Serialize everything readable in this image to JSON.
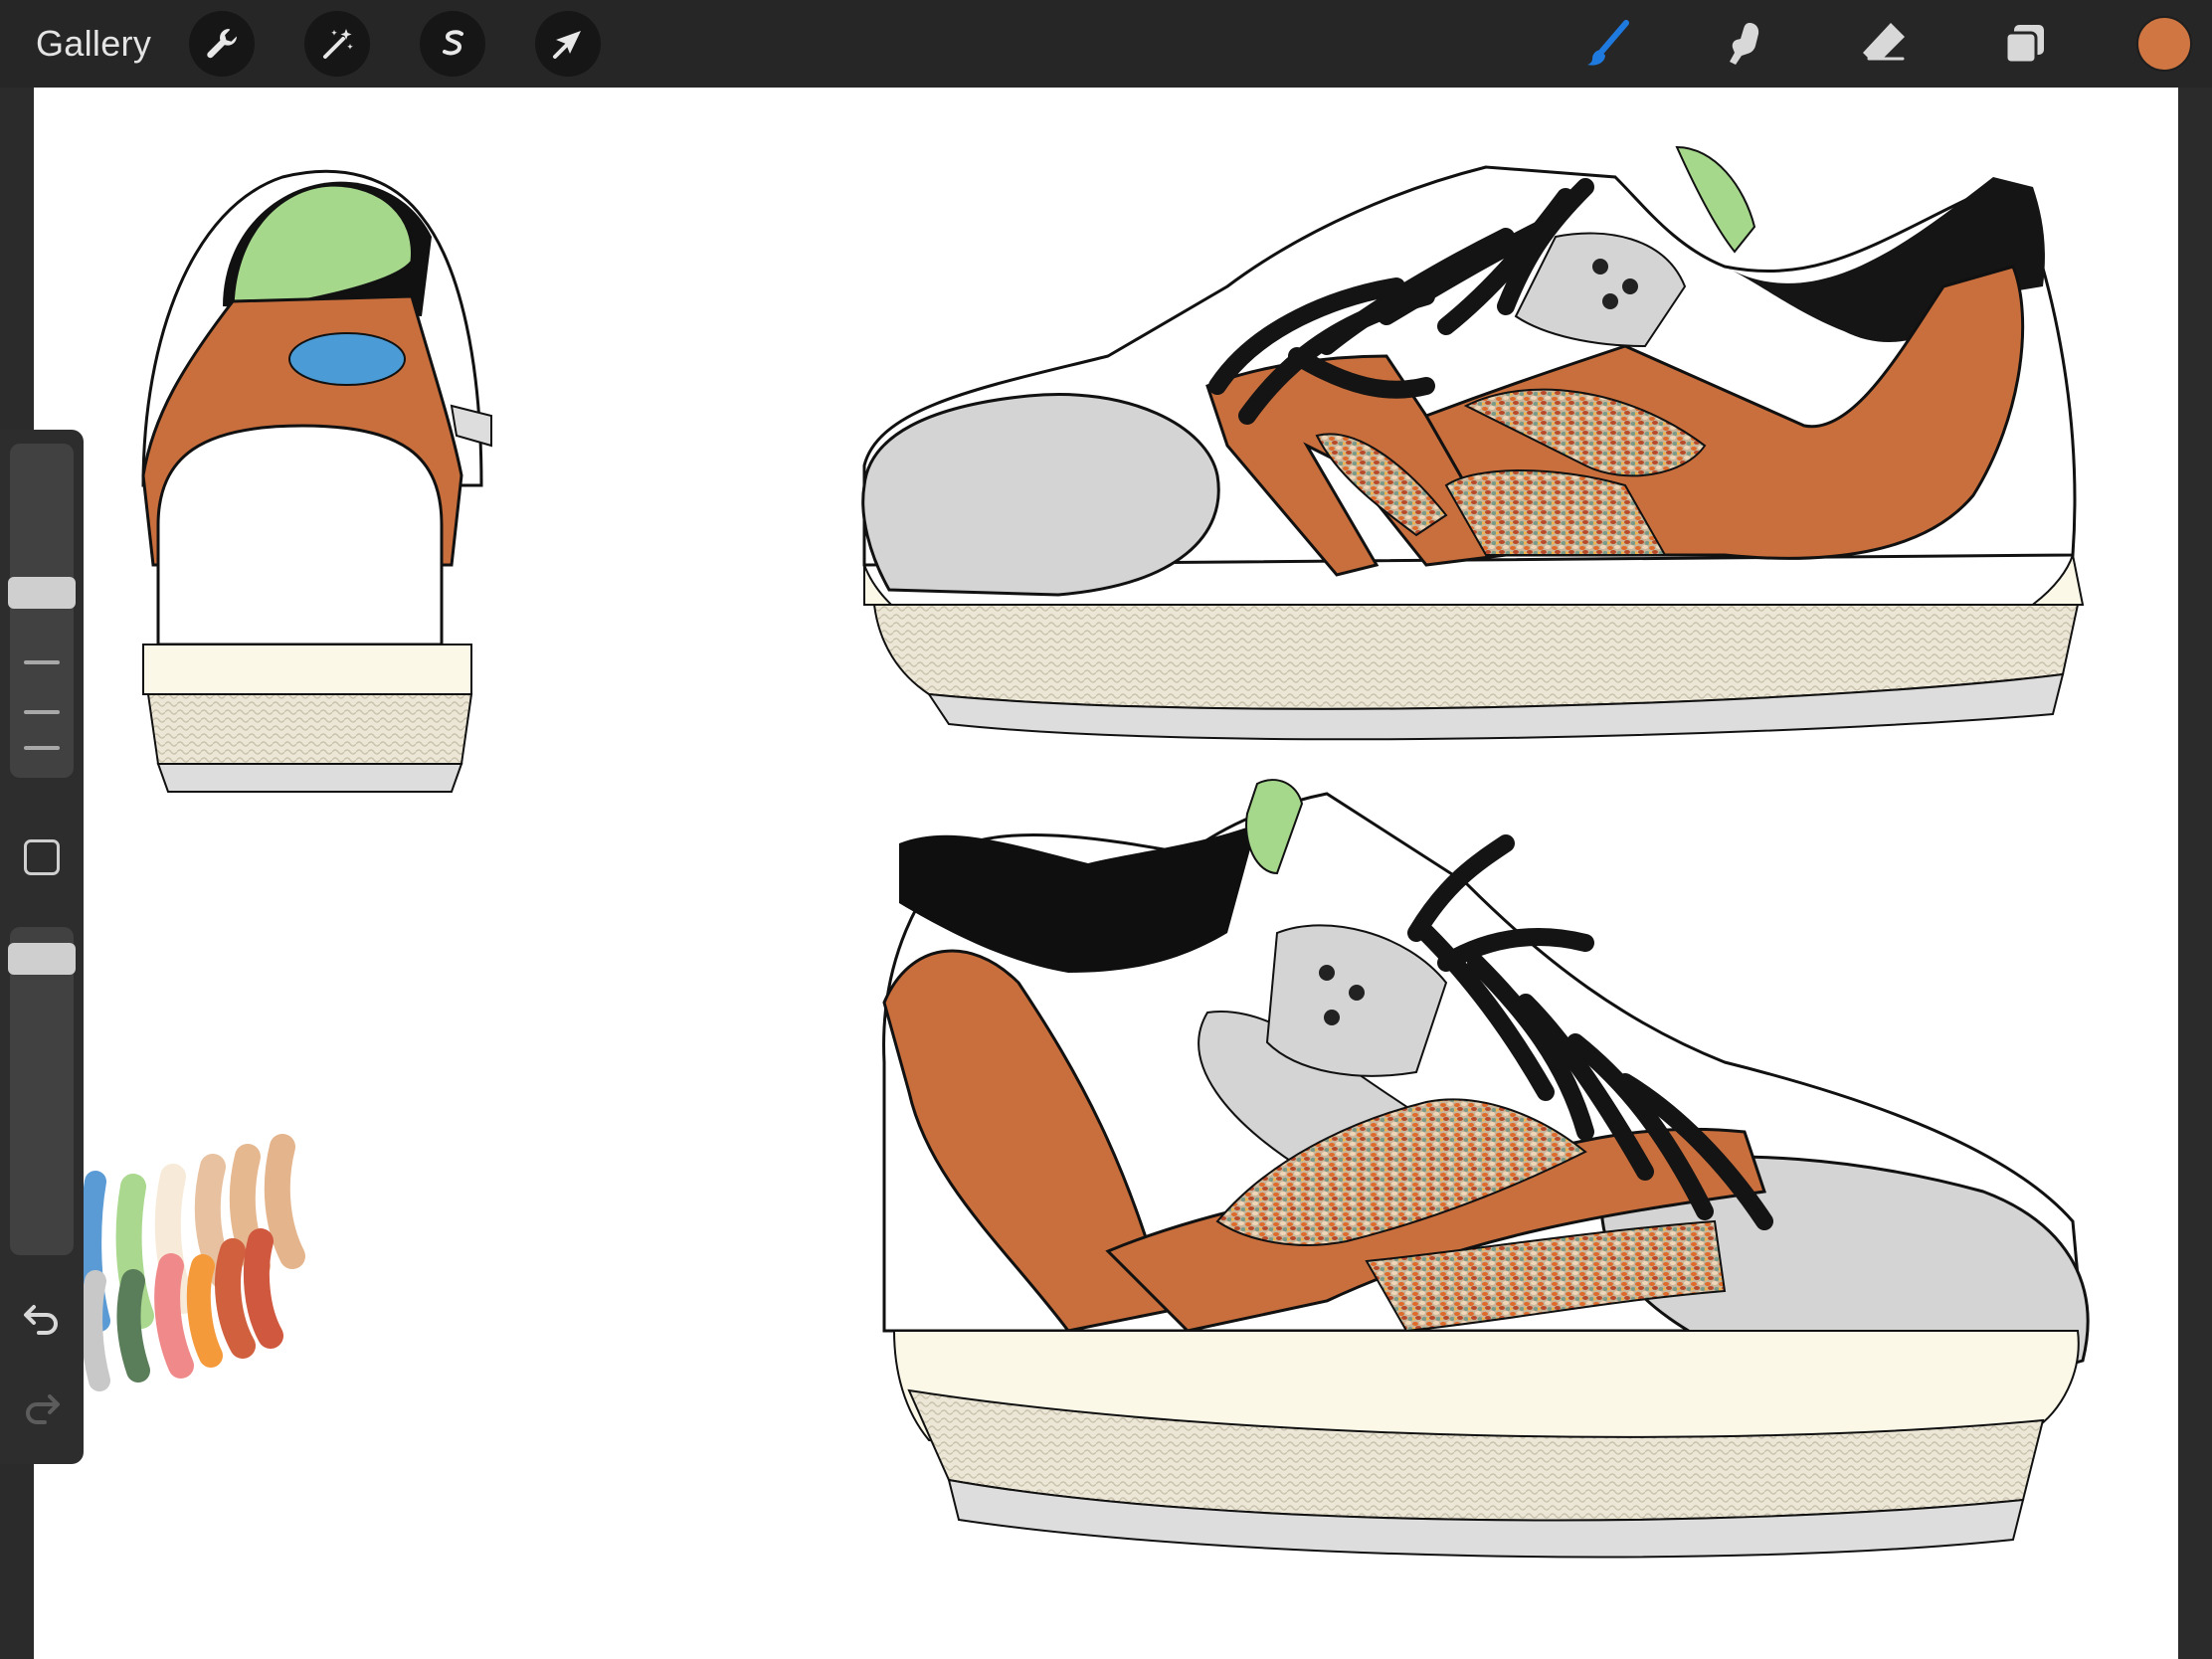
{
  "toolbar": {
    "gallery_label": "Gallery",
    "left_tools": [
      {
        "name": "actions",
        "icon": "wrench-icon"
      },
      {
        "name": "adjustments",
        "icon": "magic-wand-icon"
      },
      {
        "name": "selection",
        "icon": "selection-s-icon"
      },
      {
        "name": "transform",
        "icon": "arrow-cursor-icon"
      }
    ],
    "right_tools": [
      {
        "name": "brush",
        "icon": "brush-icon",
        "active": true
      },
      {
        "name": "smudge",
        "icon": "smudge-finger-icon",
        "active": false
      },
      {
        "name": "eraser",
        "icon": "eraser-icon",
        "active": false
      },
      {
        "name": "layers",
        "icon": "layers-icon",
        "active": false
      }
    ],
    "current_color": "#d07642",
    "active_color": "#1f7ae0"
  },
  "sidebar": {
    "brush_size_level": 0.35,
    "opacity_level": 0.95
  },
  "canvas": {
    "background": "#ffffff",
    "palette_swatches": [
      "#5b9bd5",
      "#a9d88e",
      "#f7ead8",
      "#e8c2a0",
      "#e6b890",
      "#e4b48c",
      "#c8c8c8",
      "#5a7d5a",
      "#f08a8a",
      "#f59a3a",
      "#d0603e",
      "#d0583e"
    ]
  }
}
